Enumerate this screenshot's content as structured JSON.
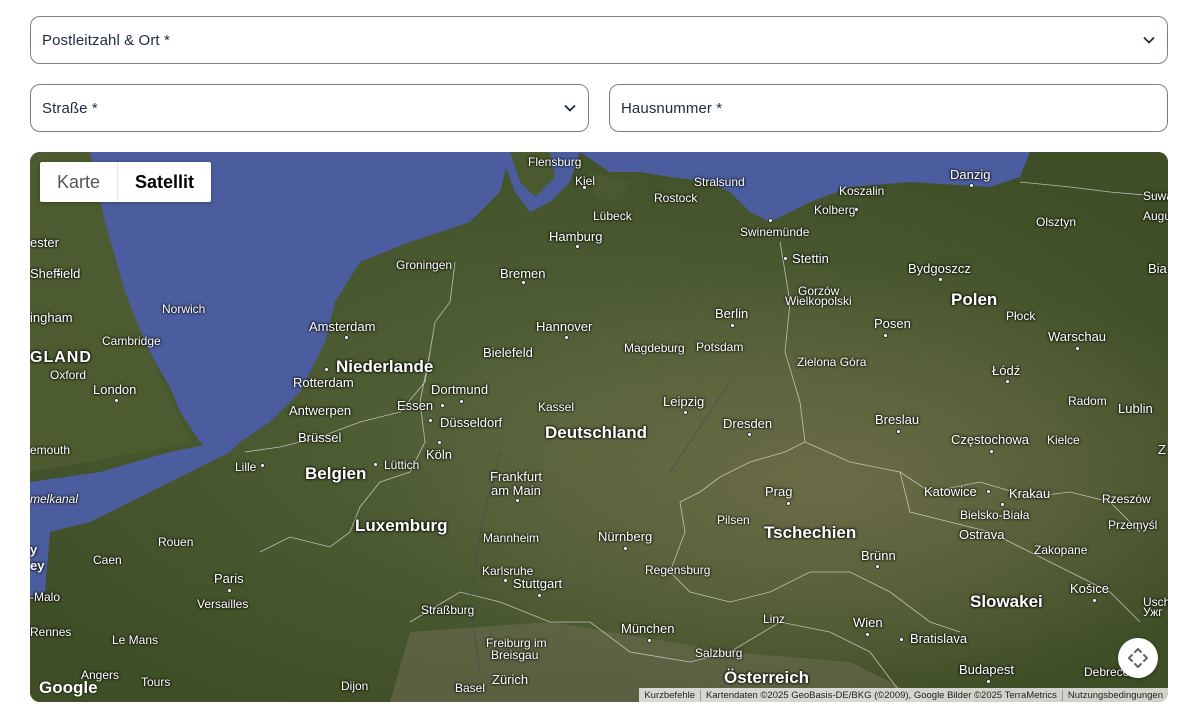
{
  "form": {
    "postal_label": "Postleitzahl & Ort *",
    "street_label": "Straße *",
    "house_label": "Hausnummer *"
  },
  "map": {
    "type_map": "Karte",
    "type_satellite": "Satellit",
    "selected_type": "Satellit",
    "logo": "Google",
    "attribution": {
      "shortcuts": "Kurzbefehle",
      "data": "Kartendaten ©2025 GeoBasis-DE/BKG (©2009), Google Bilder ©2025 TerraMetrics",
      "terms": "Nutzungsbedingungen"
    },
    "countries": {
      "deutschland": "Deutschland",
      "niederlande": "Niederlande",
      "belgien": "Belgien",
      "luxemburg": "Luxemburg",
      "polen": "Polen",
      "tschechien": "Tschechien",
      "slowakei": "Slowakei",
      "oesterreich": "Österreich",
      "england": "GLAND"
    },
    "cities": {
      "flensburg": "Flensburg",
      "kiel": "Kiel",
      "stralsund": "Stralsund",
      "koszalin": "Koszalin",
      "danzig": "Danzig",
      "rostock": "Rostock",
      "kolberg": "Kolberg",
      "luebeck": "Lübeck",
      "olsztyn": "Olsztyn",
      "swinemuende": "Swinemünde",
      "hamburg": "Hamburg",
      "stettin": "Stettin",
      "groningen": "Groningen",
      "bremen": "Bremen",
      "bydgoszcz": "Bydgoszcz",
      "gorzow": "Gorzów",
      "wielkopolski": "Wielkopolski",
      "norwich": "Norwich",
      "amsterdam": "Amsterdam",
      "berlin": "Berlin",
      "hannover": "Hannover",
      "posen": "Posen",
      "plock": "Płock",
      "cambridge": "Cambridge",
      "potsdam": "Potsdam",
      "warschau": "Warschau",
      "magdeburg": "Magdeburg",
      "bielefeld": "Bielefeld",
      "zielona_gora": "Zielona Góra",
      "oxford": "Oxford",
      "rotterdam": "Rotterdam",
      "london": "London",
      "dortmund": "Dortmund",
      "lodz": "Łódź",
      "radom": "Radom",
      "leipzig": "Leipzig",
      "essen": "Essen",
      "kassel": "Kassel",
      "antwerpen": "Antwerpen",
      "duesseldorf": "Düsseldorf",
      "breslau": "Breslau",
      "dresden": "Dresden",
      "bruessel": "Brüssel",
      "czestochowa": "Częstochowa",
      "kielce": "Kielce",
      "koeln": "Köln",
      "luettich": "Lüttich",
      "lille": "Lille",
      "frankfurt": "Frankfurt",
      "am_main": "am Main",
      "katowice": "Katowice",
      "krakau": "Krakau",
      "rzeszow": "Rzeszów",
      "prag": "Prag",
      "bielsko": "Bielsko-Biała",
      "ostrava": "Ostrava",
      "pilsen": "Pilsen",
      "przemysl": "Przemyśl",
      "mannheim": "Mannheim",
      "nuernberg": "Nürnberg",
      "bruenn": "Brünn",
      "zakopane": "Zakopane",
      "caen": "Caen",
      "rouen": "Rouen",
      "karlsruhe": "Karlsruhe",
      "paris": "Paris",
      "stuttgart": "Stuttgart",
      "regensburg": "Regensburg",
      "versailles": "Versailles",
      "kosice": "Košice",
      "strassburg": "Straßburg",
      "muenchen": "München",
      "wien": "Wien",
      "linz": "Linz",
      "bratislava": "Bratislava",
      "rennes": "Rennes",
      "le_mans": "Le Mans",
      "freiburg": "Freiburg im",
      "breisgau": "Breisgau",
      "salzburg": "Salzburg",
      "budapest": "Budapest",
      "angers": "Angers",
      "tours": "Tours",
      "dijon": "Dijon",
      "basel": "Basel",
      "zuerich": "Zürich",
      "debrecen": "Debrecen",
      "sheffield": "Sheffield",
      "ester": "ester",
      "ingham": "ingham",
      "mouth": "emouth",
      "kanal": "melkanal",
      "jersey": "ey",
      "jy": "y",
      "malo": "-Malo",
      "suw": "Suwa",
      "augu": "Augu",
      "bia": "Bia",
      "lubli": "Lublin",
      "z": "Z",
      "usch": "Usch",
      "ukr": "Ужг"
    }
  },
  "colors": {
    "field_border": "#7a8093",
    "text": "#1f2a44",
    "sea": "#4b5d9e",
    "land": "#4a5a2e"
  }
}
